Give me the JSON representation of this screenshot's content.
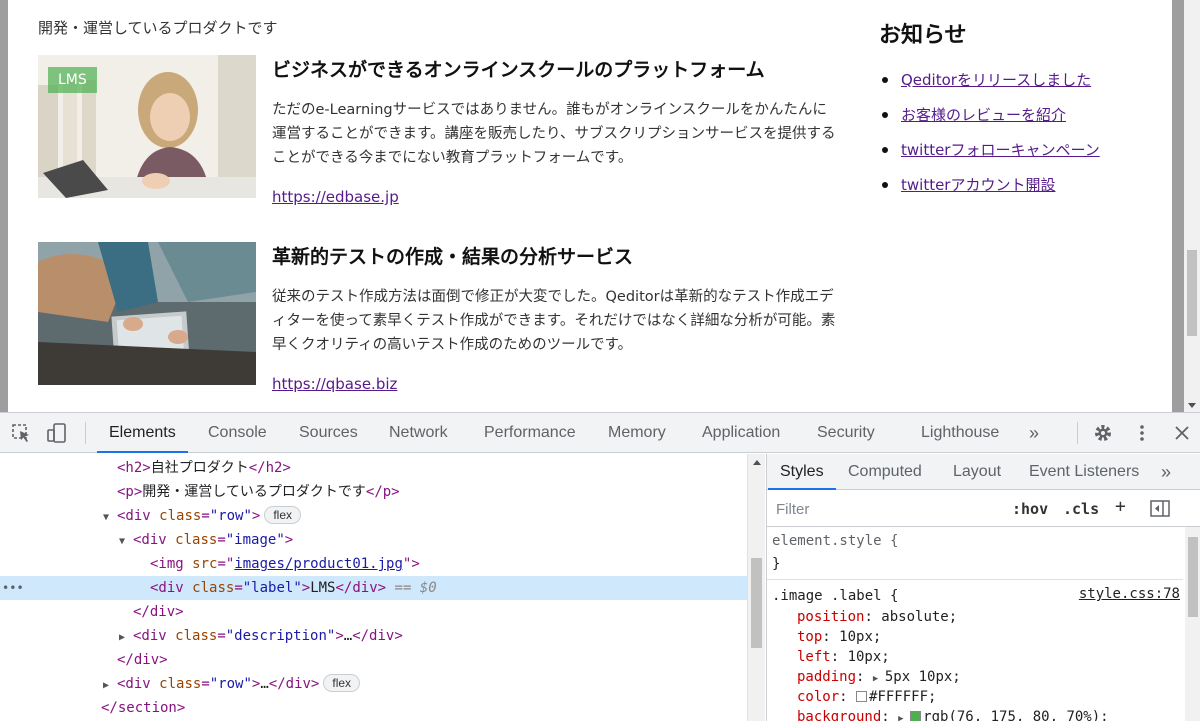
{
  "page": {
    "intro": "開発・運営しているプロダクトです",
    "products": [
      {
        "label": "LMS",
        "title": "ビジネスができるオンラインスクールのプラットフォーム",
        "desc": "ただのe-Learningサービスではありません。誰もがオンラインスクールをかんたんに運営することができます。講座を販売したり、サブスクリプションサービスを提供することができる今までにない教育プラットフォームです。",
        "link": "https://edbase.jp"
      },
      {
        "title": "革新的テストの作成・結果の分析サービス",
        "desc": "従来のテスト作成方法は面倒で修正が大変でした。Qeditorは革新的なテスト作成エディターを使って素早くテスト作成ができます。それだけではなく詳細な分析が可能。素早くクオリティの高いテスト作成のためのツールです。",
        "link": "https://qbase.biz"
      }
    ],
    "news": {
      "heading": "お知らせ",
      "items": [
        "Qeditorをリリースしました",
        "お客様のレビューを紹介",
        "twitterフォローキャンペーン",
        "twitterアカウント開設"
      ]
    }
  },
  "devtools": {
    "tabs": [
      "Elements",
      "Console",
      "Sources",
      "Network",
      "Performance",
      "Memory",
      "Application",
      "Security",
      "Lighthouse"
    ],
    "more": "»",
    "elements": {
      "h2_text": "自社プロダクト",
      "p_text": "開発・運営しているプロダクトです",
      "div_row": "div",
      "class_attr": "class",
      "row_val": "\"row\"",
      "image_val": "\"image\"",
      "label_val": "\"label\"",
      "desc_val": "\"description\"",
      "img_src_val": "images/product01.jpg",
      "label_text": "LMS",
      "badge": "flex",
      "eq": "== $0",
      "ellipsis": "…",
      "section_close": "</section>",
      "div_close": "</div>",
      "dots": "•••"
    },
    "styles": {
      "tabs": [
        "Styles",
        "Computed",
        "Layout",
        "Event Listeners"
      ],
      "more": "»",
      "filter_placeholder": "Filter",
      "hov": ":hov",
      "cls": ".cls",
      "plus": "+",
      "element_style": "element.style {",
      "close_brace": "}",
      "rule_selector": ".image .label {",
      "rule_source": "style.css:78",
      "props": [
        {
          "name": "position",
          "value": "absolute;"
        },
        {
          "name": "top",
          "value": "10px;"
        },
        {
          "name": "left",
          "value": "10px;"
        },
        {
          "name": "padding",
          "value": "5px 10px;"
        },
        {
          "name": "color",
          "value": "#FFFFFF;"
        },
        {
          "name": "background",
          "value": "rgb(76, 175, 80, 70%);"
        }
      ],
      "colors": {
        "white": "#FFFFFF",
        "green": "#4CAF50"
      }
    }
  }
}
